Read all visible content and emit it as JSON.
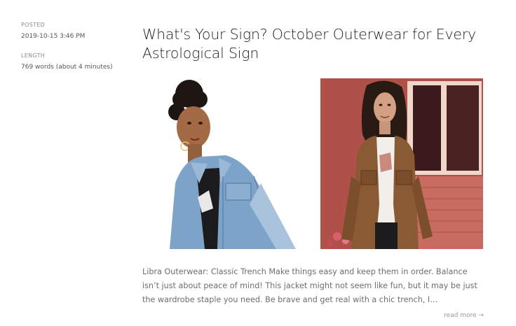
{
  "meta": {
    "posted_label": "POSTED",
    "posted_value": "2019-10-15 3:46 PM",
    "length_label": "LENGTH",
    "length_value": "769 words (about 4 minutes)"
  },
  "post": {
    "title": "What's Your Sign? October Outerwear for  Every Astrological Sign",
    "excerpt": "Libra Outerwear: Classic Trench Make things easy and keep them in order. Balance isn’t just about peace of mind! This jacket might not seem like fun, but it may be just the wardrobe staple you need. Be brave and get real with a chic trench, I…",
    "read_more": "read more →"
  },
  "images": [
    {
      "subject": "model-in-denim-jacket"
    },
    {
      "subject": "model-in-brown-corduroy-jacket"
    }
  ]
}
